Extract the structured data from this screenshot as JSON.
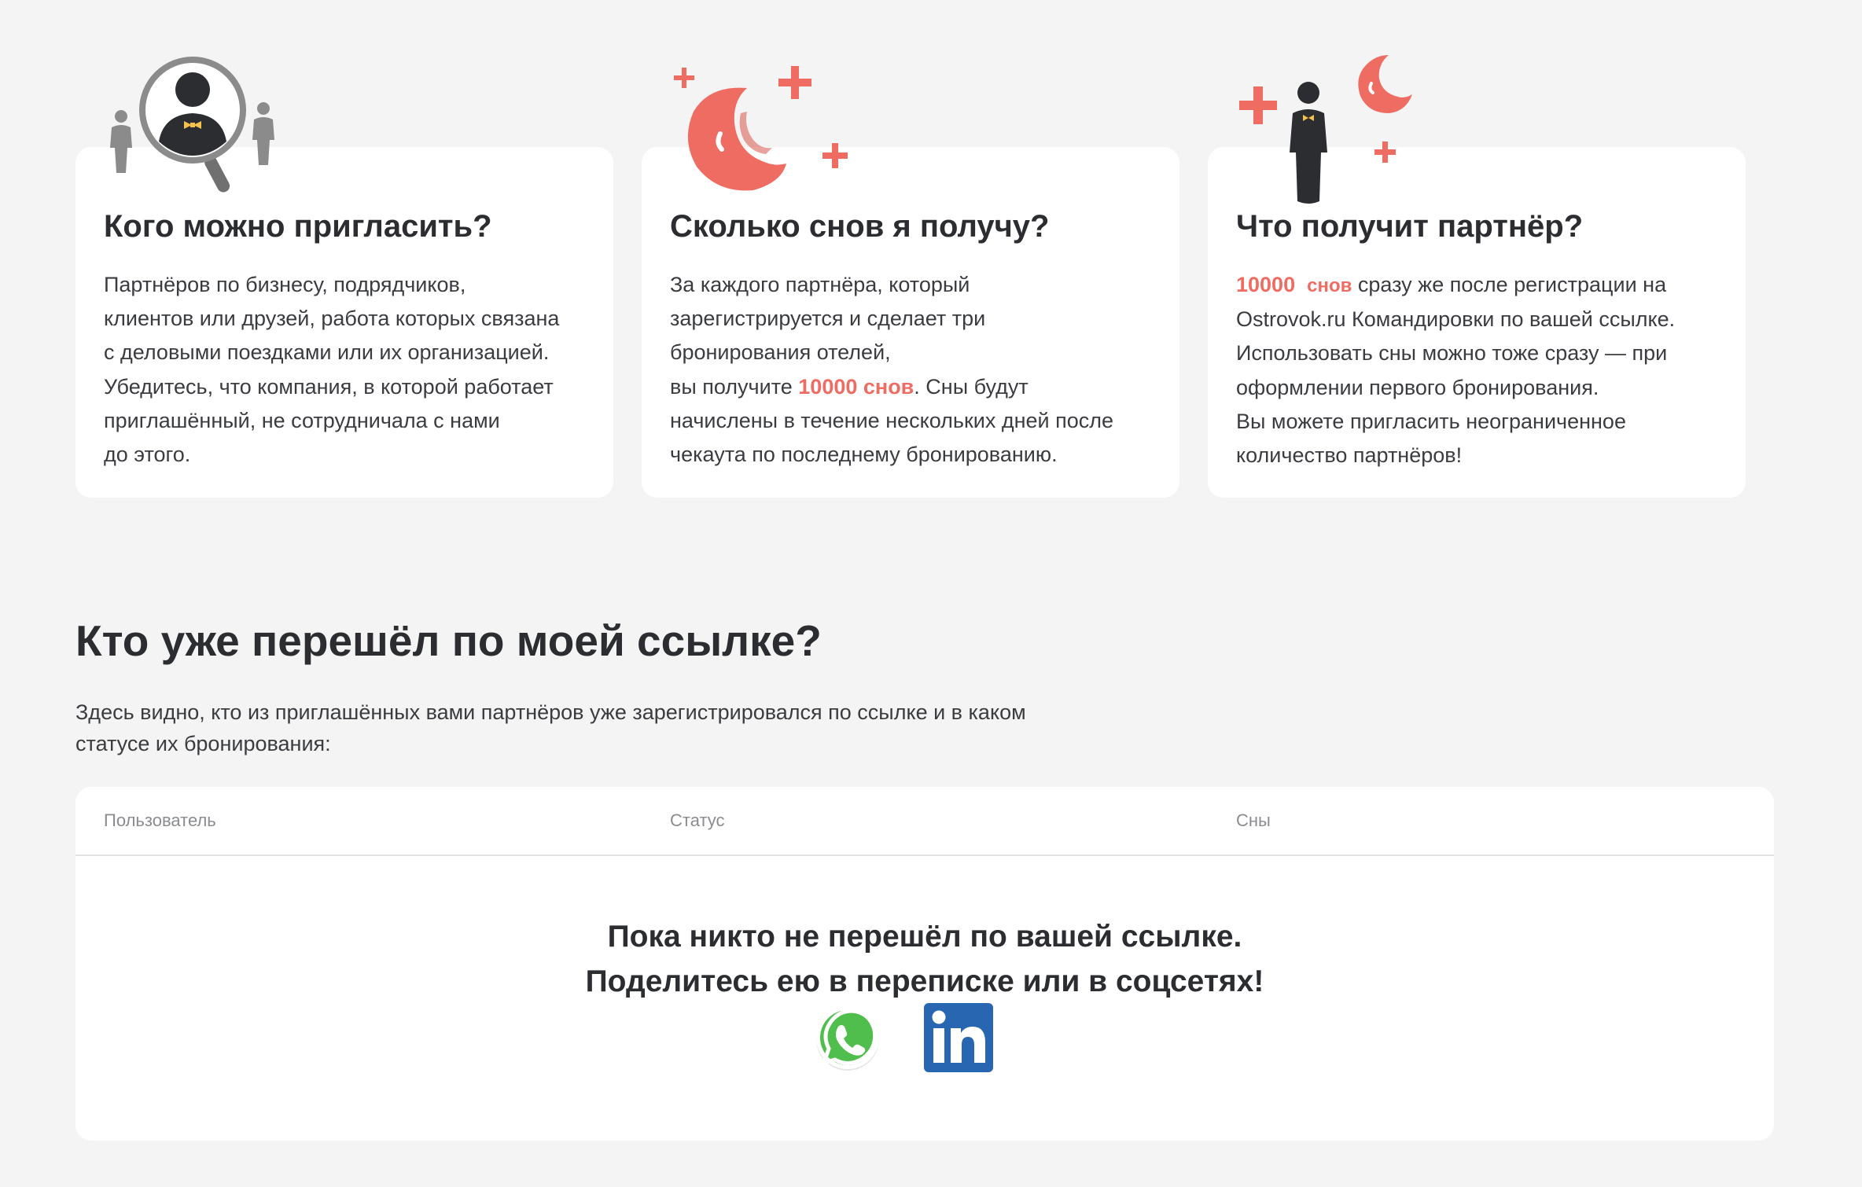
{
  "cards": [
    {
      "title": "Кого можно пригласить?",
      "icon": "magnifier-person-icon",
      "lines": [
        "Партнёров по бизнесу, подрядчиков,",
        "клиентов или друзей, работа которых связана",
        "с деловыми поездками или их организацией.",
        "Убедитесь, что компания, в которой работает",
        "приглашённый, не сотрудничала с нами",
        "до этого."
      ]
    },
    {
      "title": "Сколько снов я получу?",
      "icon": "moon-stars-icon",
      "lines": [
        "За каждого партнёра, который",
        "зарегистрируется и сделает три",
        "бронирования отелей,"
      ],
      "line4_prefix": "вы получите ",
      "line4_highlight": "10000 снов",
      "line4_suffix": ". Сны будут",
      "lines_after": [
        "начислены в течение нескольких дней после",
        "чекаута по последнему бронированию."
      ]
    },
    {
      "title": "Что получит партнёр?",
      "icon": "partner-moon-icon",
      "highlight_num": "10000",
      "highlight_word": "снов",
      "line1_suffix": " сразу же после регистрации на",
      "lines": [
        "Ostrovok.ru Командировки по вашей ссылке.",
        "Использовать сны можно тоже сразу — при",
        "оформлении первого бронирования.",
        "Вы можете пригласить неограниченное",
        "количество партнёров!"
      ]
    }
  ],
  "section": {
    "title": "Кто уже перешёл по моей ссылке?",
    "desc_line1": "Здесь видно, кто из приглашённых вами партнёров уже зарегистрировался по ссылке и в каком",
    "desc_line2": "статусе их бронирования:"
  },
  "table": {
    "col_user": "Пользователь",
    "col_status": "Статус",
    "col_dreams": "Сны",
    "empty_line1": "Пока никто не перешёл по вашей ссылке.",
    "empty_line2": "Поделитесь ею в переписке или в соцсетях!"
  },
  "share": [
    {
      "icon": "whatsapp-icon"
    },
    {
      "icon": "linkedin-icon"
    }
  ],
  "colors": {
    "accent": "#ef6c63",
    "background": "#f4f4f4",
    "text": "#2b2d31",
    "linkedin": "#2866b1",
    "whatsapp": "#4fbe4c"
  }
}
